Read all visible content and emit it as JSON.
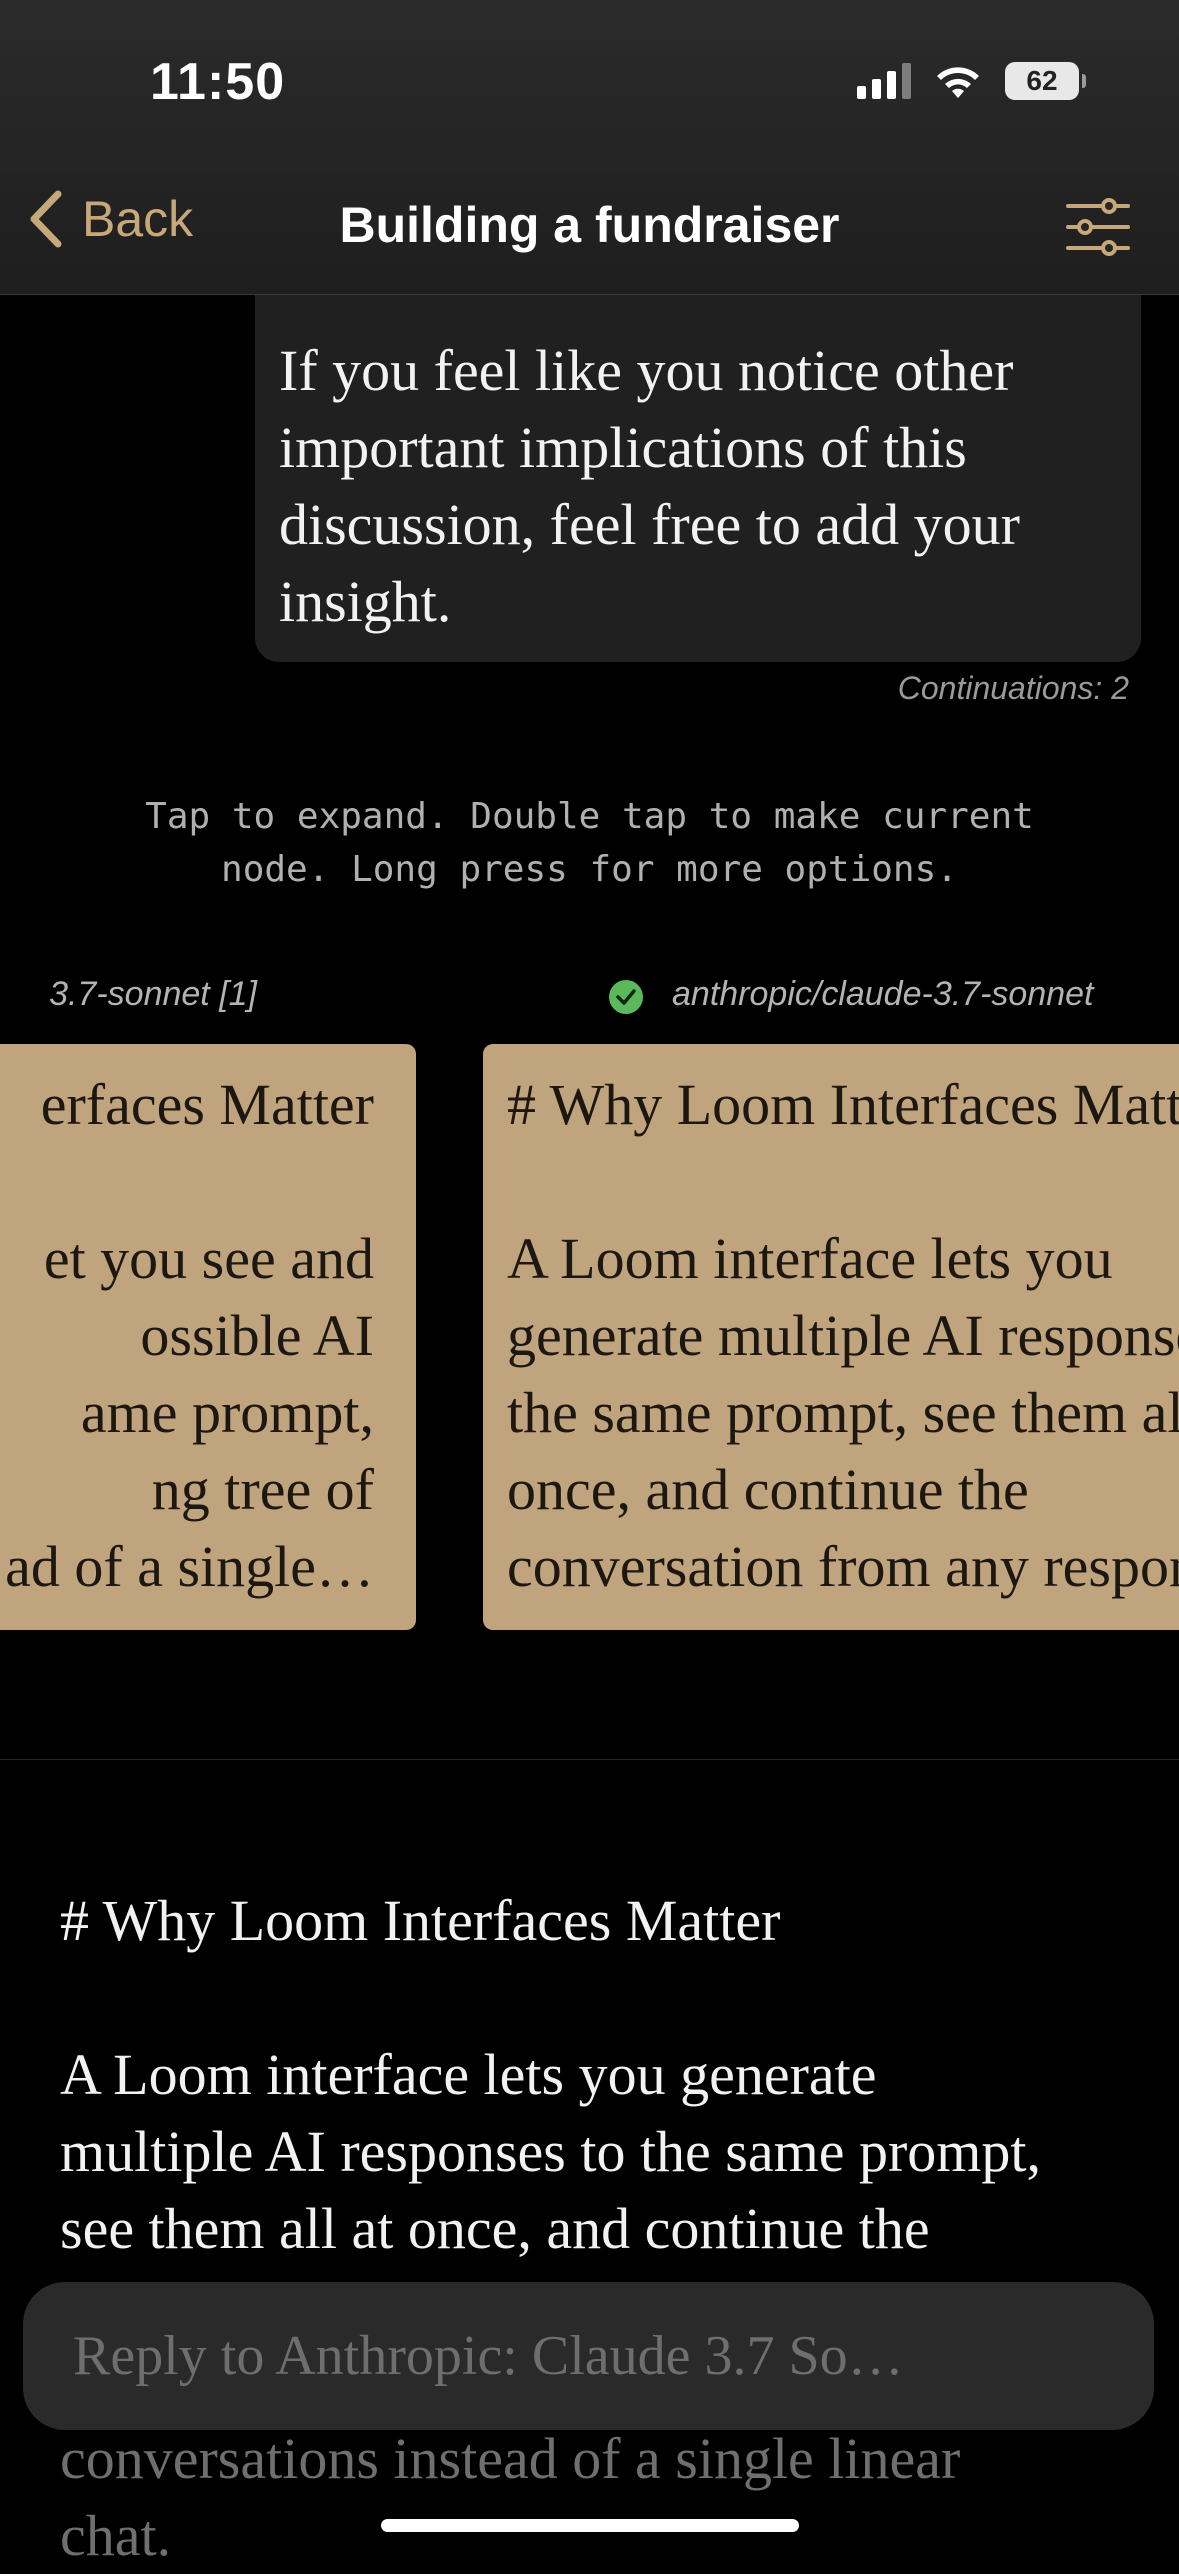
{
  "status_bar": {
    "time": "11:50",
    "battery": "62"
  },
  "nav": {
    "back_label": "Back",
    "title": "Building a fundraiser"
  },
  "message": {
    "lines": [
      "If you feel like you notice other",
      "important implications of this",
      "discussion, feel free to add your",
      "insight."
    ],
    "continuations": "Continuations: 2"
  },
  "hint": {
    "line1": "Tap to expand. Double tap to make current",
    "line2": "node. Long press for more options."
  },
  "branches": {
    "left": {
      "model": "3.7-sonnet  [1]",
      "lines": [
        "erfaces Matter",
        "",
        "et you see and",
        "ossible AI",
        "ame prompt,",
        "ng tree of",
        "ad of a single…"
      ]
    },
    "right": {
      "model": "anthropic/claude-3.7-sonnet",
      "lines": [
        "# Why Loom Interfaces Matter",
        "",
        "A Loom interface lets you",
        "generate multiple AI responses to",
        "the same prompt, see them all at",
        "once, and continue the",
        "conversation from any response"
      ]
    }
  },
  "response": {
    "heading": "# Why Loom Interfaces Matter",
    "lines": [
      "A Loom interface lets you generate",
      "multiple AI responses to the same prompt,",
      "see them all at once, and continue the"
    ]
  },
  "reply": {
    "placeholder": "Reply to Anthropic: Claude 3.7 So…"
  },
  "below_reply": {
    "lines": [
      "conversations instead of a single linear",
      "chat."
    ]
  },
  "colors": {
    "accent": "#c7a878",
    "card": "#bfa47e",
    "check": "#5cb85c"
  }
}
